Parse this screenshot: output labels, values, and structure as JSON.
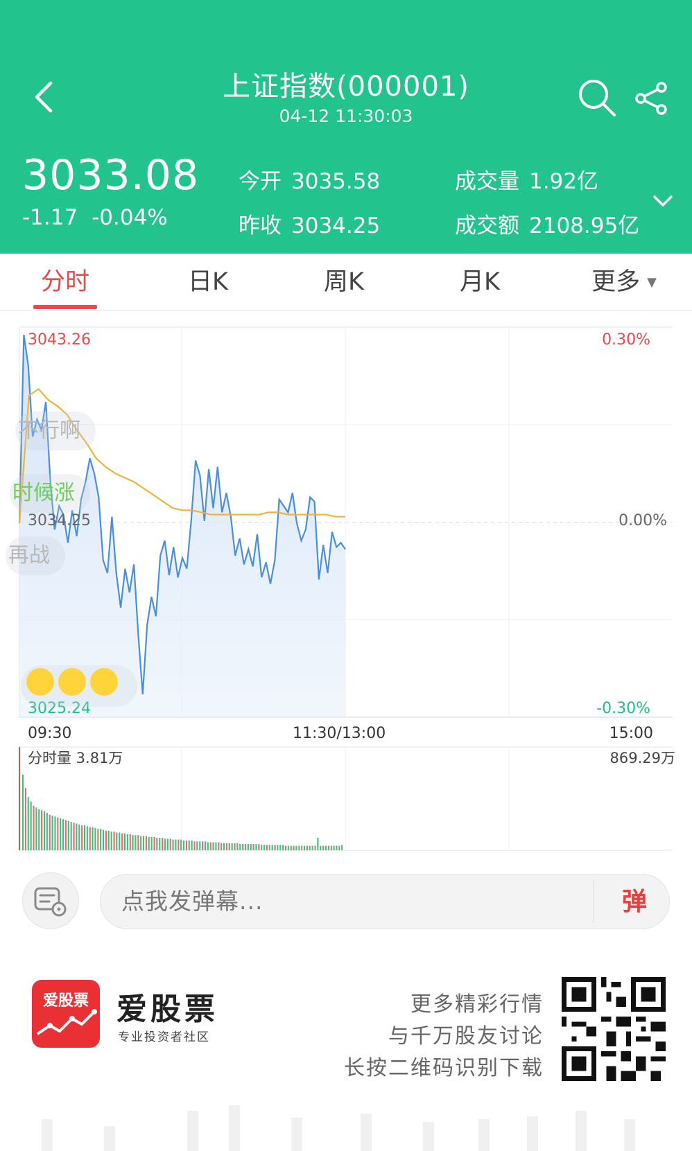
{
  "header": {
    "title": "上证指数(000001)",
    "datetime": "04-12 11:30:03",
    "price": "3033.08",
    "change": "-1.17",
    "change_pct": "-0.04%",
    "open_label": "今开",
    "open_value": "3035.58",
    "prev_close_label": "昨收",
    "prev_close_value": "3034.25",
    "volume_label": "成交量",
    "volume_value": "1.92亿",
    "turnover_label": "成交额",
    "turnover_value": "2108.95亿"
  },
  "tabs": [
    {
      "label": "分时",
      "active": true
    },
    {
      "label": "日K"
    },
    {
      "label": "周K"
    },
    {
      "label": "月K"
    },
    {
      "label": "更多"
    }
  ],
  "chart_data": [
    {
      "type": "line",
      "y_left_ticks": [
        "3043.26",
        "3034.25",
        "3025.24"
      ],
      "y_right_ticks": [
        "0.30%",
        "0.00%",
        "-0.30%"
      ],
      "x_ticks": [
        "09:30",
        "11:30/13:00",
        "15:00"
      ],
      "ylim": [
        3025.24,
        3043.26
      ],
      "baseline": 3034.25,
      "series": [
        {
          "values": [
            3034.2,
            3042.9,
            3041.5,
            3038.2,
            3039.0,
            3038.5,
            3039.8,
            3036.2,
            3033.9,
            3035.0,
            3034.6,
            3033.3,
            3034.8,
            3033.6,
            3035.3,
            3036.1,
            3037.2,
            3036.5,
            3035.4,
            3032.5,
            3031.9,
            3034.5,
            3031.9,
            3030.3,
            3032.1,
            3031.0,
            3032.3,
            3029.0,
            3026.3,
            3029.5,
            3030.8,
            3029.9,
            3032.7,
            3033.4,
            3031.8,
            3033.1,
            3031.7,
            3032.6,
            3032.1,
            3034.3,
            3037.1,
            3036.4,
            3034.3,
            3036.7,
            3034.9,
            3036.8,
            3034.7,
            3035.6,
            3034.5,
            3032.7,
            3033.5,
            3032.3,
            3033.0,
            3032.2,
            3033.7,
            3031.7,
            3032.4,
            3031.4,
            3032.5,
            3035.3,
            3035.0,
            3034.7,
            3035.6,
            3034.2,
            3033.4,
            3033.9,
            3035.4,
            3035.2,
            3031.6,
            3033.2,
            3031.9,
            3033.8,
            3033.1,
            3033.3,
            3033.0
          ]
        },
        {
          "values": [
            3034.2,
            3040.1,
            3040.4,
            3039.9,
            3039.6,
            3039.2,
            3038.5,
            3037.9,
            3037.2,
            3036.8,
            3036.5,
            3036.3,
            3036.1,
            3035.8,
            3035.5,
            3035.2,
            3034.9,
            3034.8,
            3034.8,
            3034.7,
            3034.6,
            3034.6,
            3034.6,
            3034.6,
            3034.6,
            3034.6,
            3034.7,
            3034.7,
            3034.6,
            3034.6,
            3034.6,
            3034.6,
            3034.6,
            3034.5,
            3034.5
          ]
        }
      ]
    },
    {
      "type": "bar",
      "label": "分时量 3.81万",
      "max_label": "869.29万",
      "values": [
        85,
        70,
        60,
        55,
        50,
        48,
        46,
        45,
        44,
        42,
        40,
        39,
        38,
        37,
        36,
        35,
        34,
        33,
        32,
        31,
        30,
        29,
        28,
        28,
        27,
        26,
        26,
        25,
        24,
        24,
        23,
        22,
        22,
        21,
        21,
        20,
        20,
        19,
        19,
        18,
        18,
        17,
        17,
        17,
        16,
        16,
        16,
        15,
        15,
        15,
        14,
        14,
        14,
        13,
        13,
        13,
        12,
        12,
        12,
        12,
        11,
        11,
        11,
        11,
        10,
        10,
        10,
        10,
        10,
        9,
        9,
        9,
        9,
        9,
        8,
        8,
        8,
        8,
        8,
        8,
        8,
        7,
        7,
        7,
        7,
        7,
        7,
        7,
        7,
        6,
        6,
        6,
        6,
        6,
        6,
        6,
        6,
        6,
        5,
        5,
        5,
        5,
        5,
        5,
        5,
        5,
        5,
        5,
        5,
        5,
        14,
        5,
        5,
        5,
        5,
        5,
        5,
        5,
        5,
        6
      ]
    }
  ],
  "danmaku": [
    "不行啊",
    "时候涨",
    "再战"
  ],
  "comment_input": {
    "placeholder": "点我发弹幕...",
    "send_label": "弹"
  },
  "promo": {
    "logo_text": "爱股票",
    "app_name": "爱股票",
    "tagline": "专业投资者社区",
    "line1": "更多精彩行情",
    "line2": "与千万股友讨论",
    "line3": "长按二维码识别下载"
  },
  "colors": {
    "header_bg": "#22c38d",
    "up": "#e84a4a",
    "down": "#1fbf86",
    "line": "#4a8fd8",
    "avg": "#f0b23a"
  }
}
